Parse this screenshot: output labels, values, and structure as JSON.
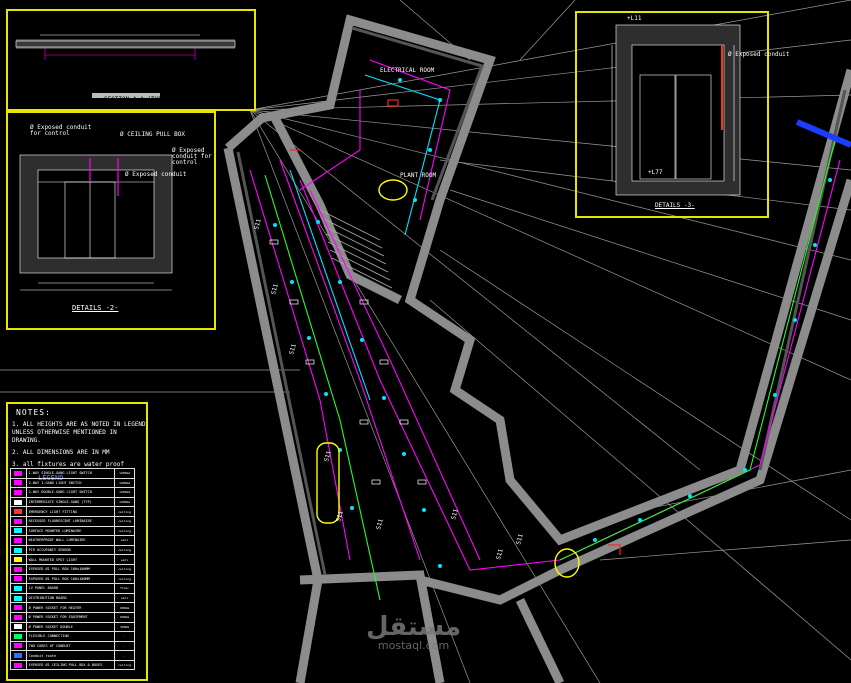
{
  "drawing": {
    "details_top_left_title": "SECTION A-A (TYP)",
    "details_2_title": "DETAILS -2-",
    "details_3_title": "DETAILS -3-",
    "callouts": [
      "Ø Exposed conduit for control",
      "Ø CEILING PULL BOX",
      "Ø Exposed conduit",
      "Ø Exposed conduit for control",
      "Ø Exposed conduit"
    ],
    "level_labels": [
      "+L11",
      "+L77"
    ],
    "circuit_label": "S11",
    "room_labels": [
      "ELECTRICAL ROOM",
      "PLANT ROOM"
    ]
  },
  "notes": {
    "heading": "NOTES:",
    "items": [
      "1. ALL HEIGHTS ARE AS NOTED IN LEGEND UNLESS OTHERWISE MENTIONED IN DRAWING.",
      "2. ALL DIMENSIONS ARE IN MM",
      "3. all fixtures are water proof"
    ]
  },
  "legend": {
    "title": "LEGEND",
    "rows": [
      {
        "color": "#ff00ff",
        "desc": "1-WAY SINGLE-GANG LIGHT SWITCH",
        "val": "1200mm"
      },
      {
        "color": "#ff00ff",
        "desc": "2-WAY 1-GANG LIGHT SWITCH",
        "val": "1200mm"
      },
      {
        "color": "#ff00ff",
        "desc": "2-WAY DOUBLE-GANG LIGHT SWITCH",
        "val": "1200mm"
      },
      {
        "color": "#ffffff",
        "desc": "INTERMEDIATE SINGLE-GANG (TYP)",
        "val": "1200mm"
      },
      {
        "color": "#ff3333",
        "desc": "EMERGENCY LIGHT FITTING",
        "val": "ceiling"
      },
      {
        "color": "#ff00ff",
        "desc": "RECESSED FLUORESCENT LUMINAIRE",
        "val": "ceiling"
      },
      {
        "color": "#00ffff",
        "desc": "SURFACE MOUNTED LUMINAIRE",
        "val": "ceiling"
      },
      {
        "color": "#ff00ff",
        "desc": "WEATHERPROOF WALL LUMINAIRE",
        "val": "wall"
      },
      {
        "color": "#00ffff",
        "desc": "PIR OCCUPANCY SENSOR",
        "val": "ceiling"
      },
      {
        "color": "#ffff00",
        "desc": "WALL MOUNTED SPOT LIGHT",
        "val": "wall"
      },
      {
        "color": "#ff00ff",
        "desc": "EXPOSED Ø1 PULL BOX 100x100MM",
        "val": "ceiling"
      },
      {
        "color": "#ff00ff",
        "desc": "EXPOSED Ø1 PULL BOX 100x100MM",
        "val": "ceiling"
      },
      {
        "color": "#00ffff",
        "desc": "LV PANEL BOARD",
        "val": "floor"
      },
      {
        "color": "#00ffff",
        "desc": "DISTRIBUTION BOARD",
        "val": "wall"
      },
      {
        "color": "#ff00ff",
        "desc": "Ø POWER SOCKET FOR HEATER",
        "val": "600mm"
      },
      {
        "color": "#ff00ff",
        "desc": "Ø POWER SOCKET FOR EQUIPMENT",
        "val": "600mm"
      },
      {
        "color": "#ffffff",
        "desc": "Ø POWER SOCKET DOUBLE",
        "val": "300mm"
      },
      {
        "color": "#00ff66",
        "desc": "FLEXIBLE CONNECTION",
        "val": "-"
      },
      {
        "color": "#ff00ff",
        "desc": "TWO CORES OF CONDUIT",
        "val": "-"
      },
      {
        "color": "#3a6bff",
        "desc": "Conduit route",
        "val": "-"
      },
      {
        "color": "#ff00ff",
        "desc": "EXPOSED Ø1 CEILING PULL BOX & BOXES",
        "val": "ceiling"
      }
    ]
  },
  "watermark": {
    "arabic": "مستقل",
    "latin": "mostaql.com"
  }
}
